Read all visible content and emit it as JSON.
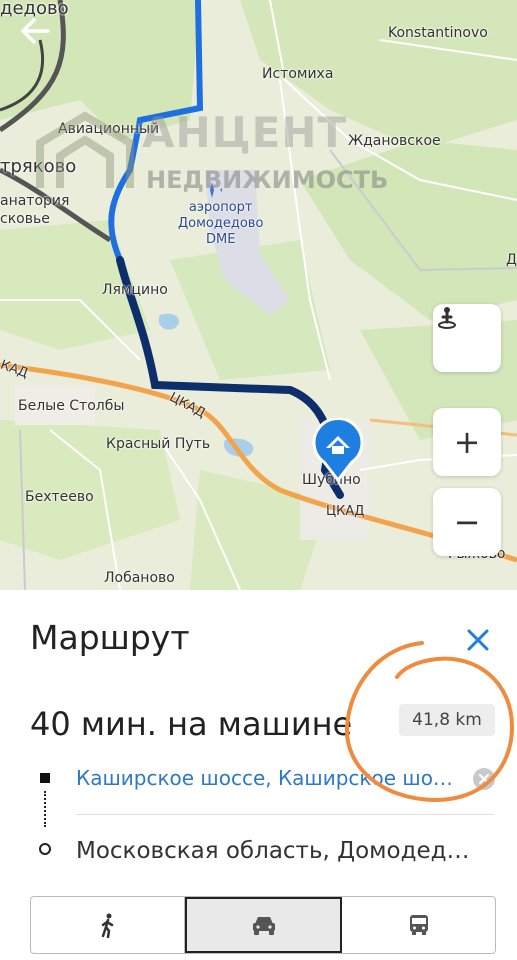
{
  "map": {
    "places": [
      {
        "id": "domodedovo",
        "text": "дедово"
      },
      {
        "id": "konstantinovo",
        "text": "Konstantinovo"
      },
      {
        "id": "istomikha",
        "text": "Истомиха"
      },
      {
        "id": "aviatsionny",
        "text": "Авиационный"
      },
      {
        "id": "zhdanovskoe",
        "text": "Ждановское"
      },
      {
        "id": "petryakovo",
        "text": "тряково"
      },
      {
        "id": "sanatoriya",
        "text": "анатория"
      },
      {
        "id": "moskovye",
        "text": "сковье"
      },
      {
        "id": "lyamtsino",
        "text": "Лямцино"
      },
      {
        "id": "belye_stolby",
        "text": "Белые Столбы"
      },
      {
        "id": "krasny_put",
        "text": "Красный Путь"
      },
      {
        "id": "shubino",
        "text": "Шубино"
      },
      {
        "id": "bekhteevo",
        "text": "Бехтеево"
      },
      {
        "id": "lobanovo",
        "text": "Лобаново"
      },
      {
        "id": "ryzhevo",
        "text": "Рыжово"
      },
      {
        "id": "d_edge",
        "text": "Д"
      }
    ],
    "airport": {
      "line1": "аэропорт",
      "line2": "Домодедово",
      "line3": "DME"
    },
    "road_labels": [
      {
        "id": "ckad1",
        "text": "ЦКАД"
      },
      {
        "id": "ckad2",
        "text": "ЦКАД"
      },
      {
        "id": "kad_left",
        "text": "КАД"
      }
    ],
    "watermark": {
      "line1": "АНЦЕНТ",
      "line2": "НЕДВИЖИМОСТЬ"
    },
    "route_color": "#0d2d6b",
    "route_light_color": "#1f6fe0",
    "highway_color": "#f2a34a",
    "marker_color": "#1e7fe0"
  },
  "controls": {
    "back_icon": "arrow-left-icon",
    "zoom_in": "+",
    "zoom_out": "−",
    "location_icon": "person-pin-icon"
  },
  "panel": {
    "title": "Маршрут",
    "duration": "40 мин. на машине",
    "distance": "41,8 km",
    "from": "Каширское шоссе, Каширское шо…",
    "to": "Московская область, Домодед…",
    "modes": [
      {
        "name": "walk",
        "icon": "walk-icon",
        "active": false
      },
      {
        "name": "car",
        "icon": "car-icon",
        "active": true
      },
      {
        "name": "bus",
        "icon": "bus-icon",
        "active": false
      }
    ]
  }
}
